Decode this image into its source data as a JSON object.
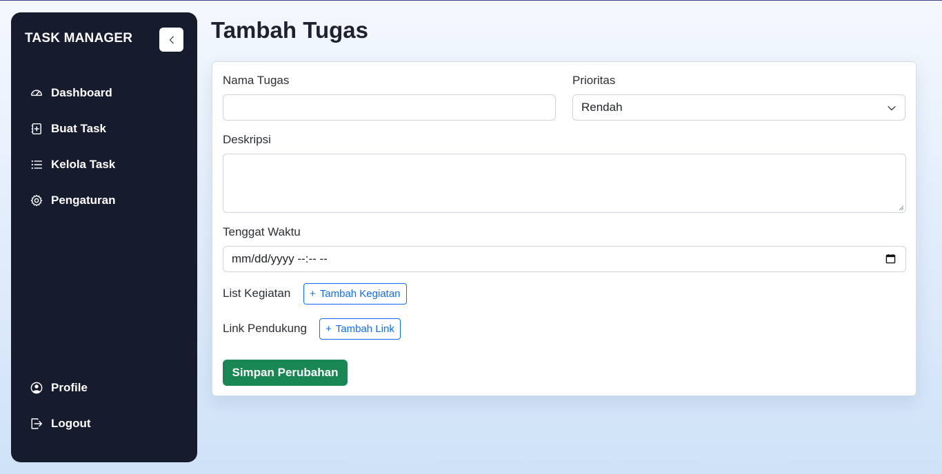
{
  "sidebar": {
    "brand": "TASK MANAGER",
    "items": [
      {
        "label": "Dashboard",
        "icon": "speedometer-icon"
      },
      {
        "label": "Buat Task",
        "icon": "file-plus-icon"
      },
      {
        "label": "Kelola Task",
        "icon": "list-icon"
      },
      {
        "label": "Pengaturan",
        "icon": "gear-icon"
      }
    ],
    "bottom_items": [
      {
        "label": "Profile",
        "icon": "user-circle-icon"
      },
      {
        "label": "Logout",
        "icon": "logout-icon"
      }
    ]
  },
  "main": {
    "title": "Tambah Tugas",
    "form": {
      "name_label": "Nama Tugas",
      "name_value": "",
      "priority_label": "Prioritas",
      "priority_value": "Rendah",
      "description_label": "Deskripsi",
      "description_value": "",
      "deadline_label": "Tenggat Waktu",
      "deadline_placeholder": "mm/dd/yyyy --:-- --",
      "activities_label": "List Kegiatan",
      "add_activity_label": "Tambah Kegiatan",
      "links_label": "Link Pendukung",
      "add_link_label": "Tambah Link",
      "save_label": "Simpan Perubahan"
    }
  },
  "colors": {
    "sidebar_bg": "#161b2e",
    "primary": "#0d6efd",
    "success": "#198754"
  }
}
